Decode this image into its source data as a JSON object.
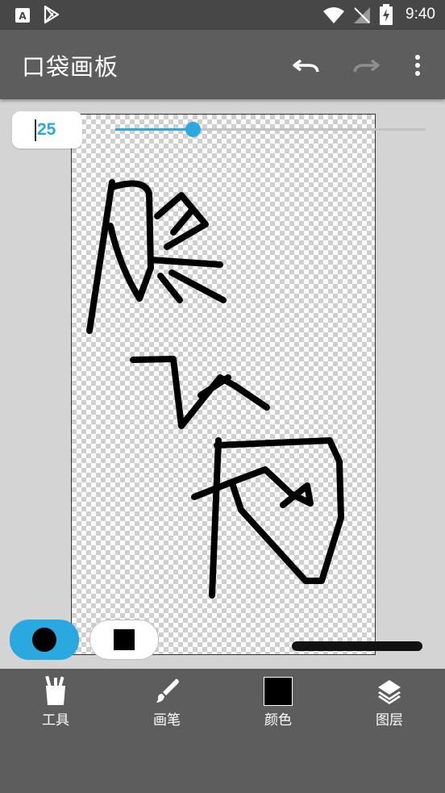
{
  "status": {
    "time": "9:40"
  },
  "app": {
    "title": "口袋画板"
  },
  "brush": {
    "size": "25",
    "size_fraction": 0.25
  },
  "toolbar": {
    "tools": "工具",
    "brush": "画笔",
    "color": "颜色",
    "layers": "图层"
  },
  "colors": {
    "accent": "#2aa8e0",
    "stroke": "#000000",
    "bar": "#5d5d5d"
  }
}
